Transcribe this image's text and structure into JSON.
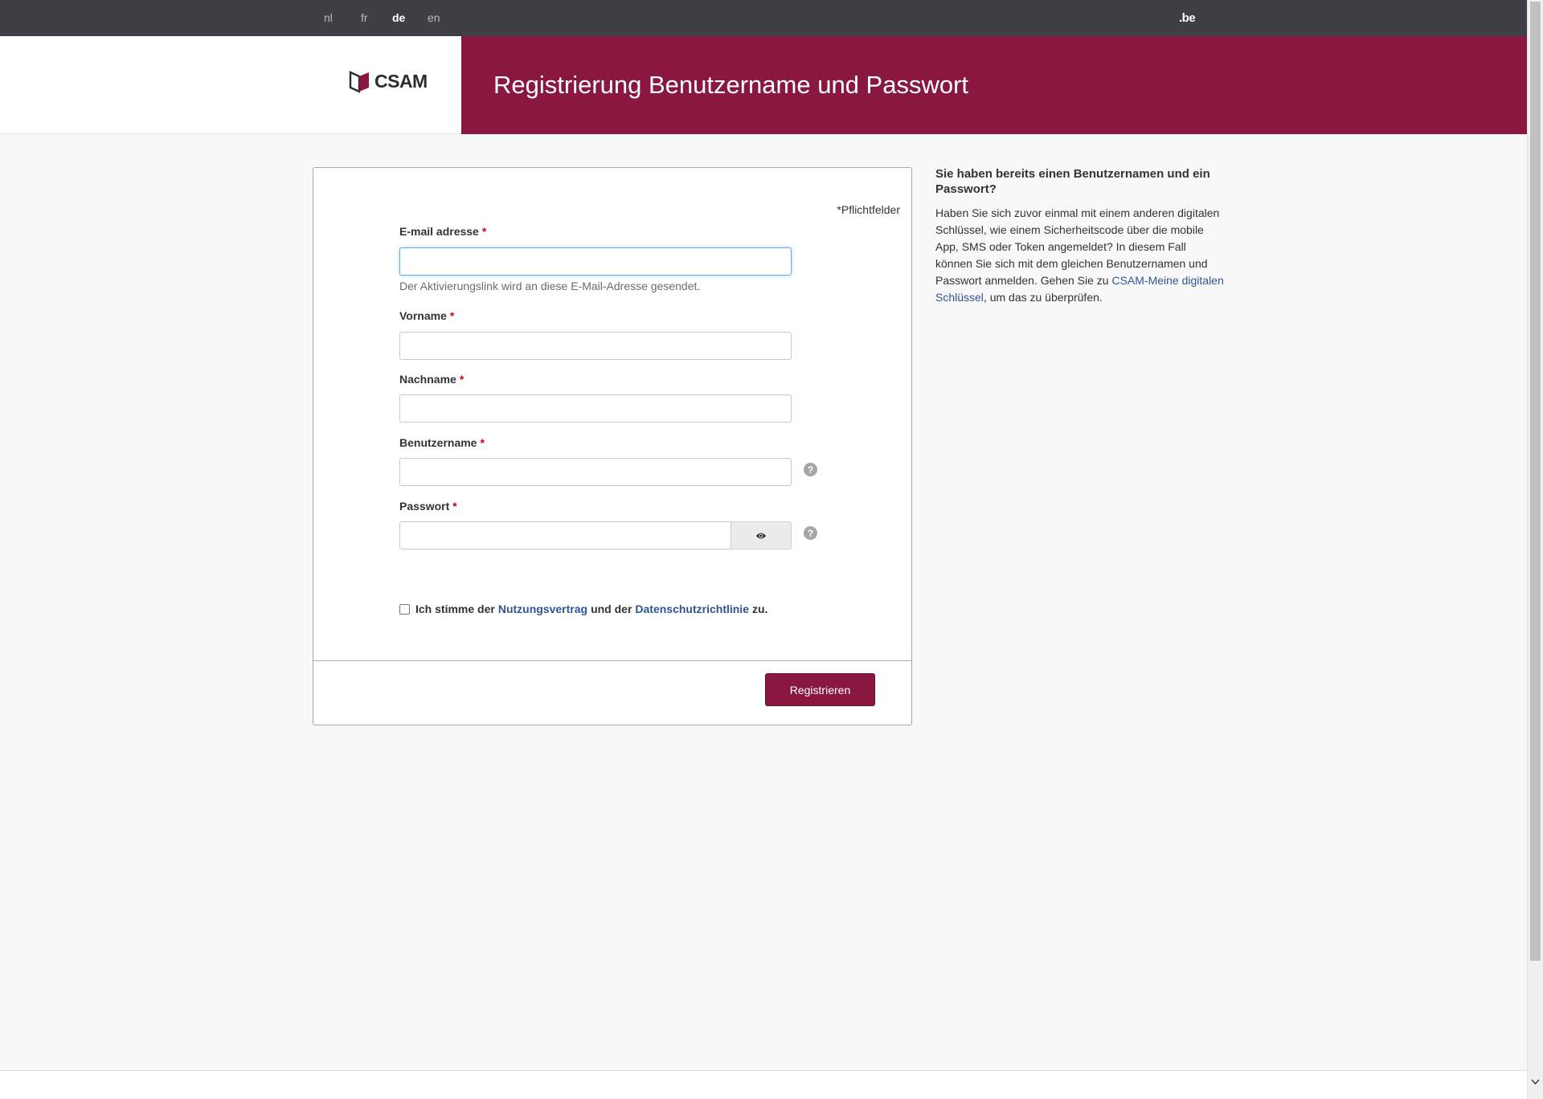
{
  "languages": [
    {
      "code": "nl",
      "active": false
    },
    {
      "code": "fr",
      "active": false
    },
    {
      "code": "de",
      "active": true
    },
    {
      "code": "en",
      "active": false
    }
  ],
  "top_bar": {
    "be_logo": ".be"
  },
  "header": {
    "logo_text": "CSAM",
    "title": "Registrierung Benutzername und Passwort"
  },
  "form": {
    "required_note": "*Pflichtfelder",
    "required_marker": "*",
    "email": {
      "label": "E-mail adresse",
      "value": "",
      "help": "Der Aktivierungslink wird an diese E-Mail-Adresse gesendet."
    },
    "firstname": {
      "label": "Vorname",
      "value": ""
    },
    "lastname": {
      "label": "Nachname",
      "value": ""
    },
    "username": {
      "label": "Benutzername",
      "value": ""
    },
    "password": {
      "label": "Passwort",
      "value": ""
    },
    "help_icon_glyph": "?",
    "terms": {
      "checked": false,
      "prefix": "Ich stimme der",
      "link1": "Nutzungsvertrag",
      "middle": "und der",
      "link2": "Datenschutzrichtlinie",
      "suffix": "zu."
    },
    "submit_label": "Registrieren"
  },
  "sidebar": {
    "title": "Sie haben bereits einen Benutzernamen und ein Passwort?",
    "text_before": "Haben Sie sich zuvor einmal mit einem anderen digitalen Schlüssel, wie einem Sicherheitscode über die mobile App, SMS oder Token angemeldet? In diesem Fall können Sie sich mit dem gleichen Benutzernamen und Passwort anmelden. Gehen Sie zu ",
    "link": "CSAM-Meine digitalen Schlüssel",
    "text_after": ", um das zu überprüfen."
  },
  "colors": {
    "brand": "#8a1742",
    "topbar": "#3f4045",
    "link": "#2f5496",
    "required": "#d0021b"
  },
  "icons": [
    "csam-logo-icon",
    "eye-icon",
    "help-icon",
    "chevron-down-icon"
  ]
}
